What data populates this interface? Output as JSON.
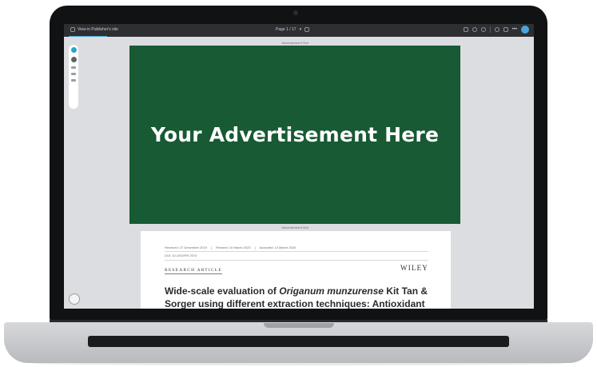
{
  "viewer": {
    "back_link": "View in Publisher's site",
    "page_indicator": "Page 1 / 17",
    "tab_accent": "#4aa6d8"
  },
  "ad": {
    "top_label": "Advertisement Slot",
    "bottom_label": "Advertisement Slot",
    "headline": "Your Advertisement Here",
    "background": "#175a34"
  },
  "article": {
    "received": "Received: 27 December 2019",
    "revised": "Revised: 10 March 2020",
    "accepted": "Accepted: 14 March 2020",
    "doi": "DOI: 10.1002/FR.2074",
    "section": "RESEARCH ARTICLE",
    "publisher": "WILEY",
    "title_pre": "Wide-scale evaluation of ",
    "title_italic": "Origanum munzurense",
    "title_post": " Kit Tan & Sorger using different extraction techniques: Antioxidant"
  },
  "icons": {
    "back": "external-link-icon",
    "page_nav": "page-grid-icon",
    "fullscreen": "fullscreen-icon",
    "info": "info-icon",
    "settings": "gear-icon",
    "search": "search-icon",
    "tools": "tools-icon",
    "more": "more-icon",
    "user": "user-avatar-icon"
  }
}
